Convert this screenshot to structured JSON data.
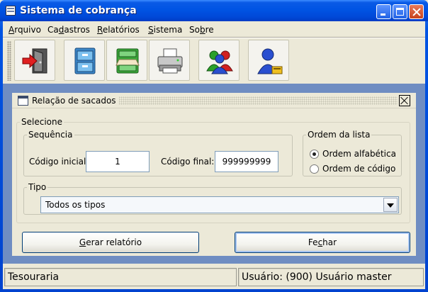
{
  "window": {
    "title": "Sistema de cobrança"
  },
  "menu": [
    {
      "pre": "",
      "key": "A",
      "post": "rquivo"
    },
    {
      "pre": "Ca",
      "key": "d",
      "post": "astros"
    },
    {
      "pre": "",
      "key": "R",
      "post": "elatórios"
    },
    {
      "pre": "",
      "key": "S",
      "post": "istema"
    },
    {
      "pre": "So",
      "key": "b",
      "post": "re"
    }
  ],
  "toolbar": {
    "icons": [
      "exit-door-icon",
      "file-cabinet-icon",
      "green-file-drawer-icon",
      "printer-icon",
      "users-group-icon",
      "user-admin-icon"
    ]
  },
  "dialog": {
    "title": "Relação de sacados",
    "selecione": "Selecione",
    "sequencia": "Sequência",
    "codigo_inicial_label": "Código inicial:",
    "codigo_inicial_value": "1",
    "codigo_final_label": "Código final:",
    "codigo_final_value": "999999999",
    "ordem": {
      "legend": "Ordem da lista",
      "alfabetica": "Ordem alfabética",
      "codigo": "Ordem de código",
      "selected": "alfabetica"
    },
    "tipo": {
      "legend": "Tipo",
      "selected": "Todos os tipos"
    },
    "buttons": {
      "gerar": {
        "pre": "",
        "key": "G",
        "post": "erar relatório"
      },
      "fechar": {
        "pre": "Fe",
        "key": "c",
        "post": "har"
      }
    }
  },
  "status": {
    "left": "Tesouraria",
    "right": "Usuário: (900) Usuário master"
  }
}
